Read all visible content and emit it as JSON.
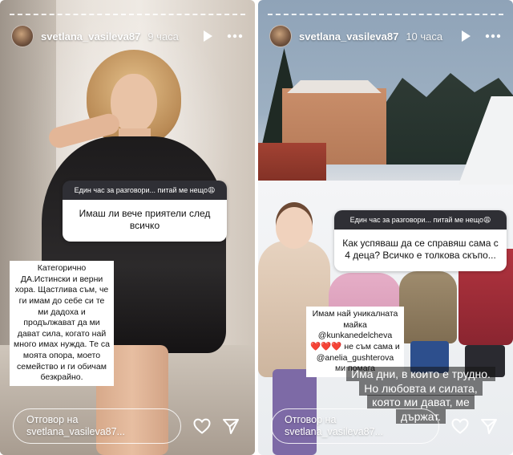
{
  "stories": [
    {
      "username": "svetlana_vasileva87",
      "time": "9 часа",
      "question_header": "Един час за разговори... питай ме нещо😩",
      "question": "Имаш ли вече приятели след всичко",
      "answer": "Категорично ДА.Истински и верни хора. Щастлива съм, че ги имам до себе си те ми дадоха и продължават да ми дават сила, когато най много имах нужда. Те са моята опора, моето семейство и ги обичам безкрайно.",
      "reply_placeholder": "Отговор на svetlana_vasileva87..."
    },
    {
      "username": "svetlana_vasileva87",
      "time": "10 часа",
      "question_header": "Един час за разговори... питай ме нещо😩",
      "question": "Как успяваш да се справяш сама с 4 деца? Всичко е толкова скъпо...",
      "answer_box": {
        "line1": "Имам най уникалната майка @kunkanedelcheva",
        "line2": "❤️❤️❤️ не съм сама и",
        "line3": "@anelia_gushterova ми помага"
      },
      "bubble_lines": [
        "Има дни, в които е трудно.",
        "Но любовта и силата,",
        "която ми дават, ме",
        "държат."
      ],
      "reply_placeholder": "Отговор на svetlana_vasileva87..."
    }
  ],
  "icons": {
    "play": "play-icon",
    "more": "more-icon",
    "like": "heart-icon",
    "share": "send-icon"
  }
}
